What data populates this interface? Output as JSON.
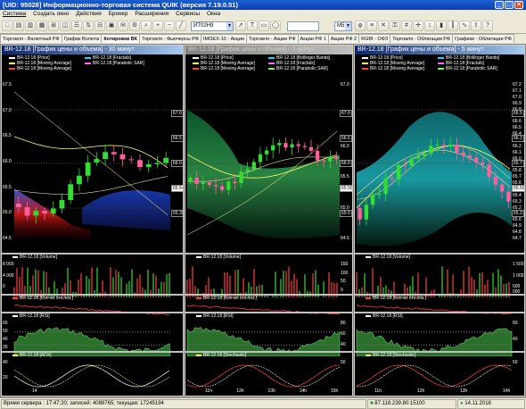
{
  "window": {
    "title": "[UID: 95028] Информационно-торговая система QUIK (версия 7.19.0.51)",
    "minimize": "_",
    "maximize": "□",
    "close": "✕"
  },
  "menu": [
    "Система",
    "Создать окно",
    "Действия",
    "Брокер",
    "Расширения",
    "Сервисы",
    "Окна"
  ],
  "toolbar": {
    "instrument": "ИТ02Н9",
    "interval": "M5",
    "icons": [
      "new-window-icon",
      "open-icon",
      "save-icon",
      "print-icon",
      "table-icon",
      "chart-icon",
      "quote-icon",
      "order-icon",
      "stop-icon",
      "portfolio-icon",
      "news-icon",
      "settings-icon",
      "search-icon",
      "zoom-in-icon",
      "zoom-out-icon",
      "line-icon",
      "arrow-icon",
      "text-icon",
      "rect-icon",
      "ellipse-icon",
      "fib-icon",
      "channel-icon",
      "delete-icon",
      "lock-icon",
      "grid-icon",
      "crosshair-icon",
      "scale-icon",
      "candle-icon",
      "bar-icon",
      "linechart-icon",
      "export-icon",
      "help-icon"
    ]
  },
  "tabs": [
    {
      "label": "Торговля - Валютный РФ"
    },
    {
      "label": "График Волюта"
    },
    {
      "label": "Котировки ВК",
      "active": true
    },
    {
      "label": "Торговля - Фьючерсы РФ"
    },
    {
      "label": "IMOEX-10 - Акции"
    },
    {
      "label": "Торговля - Акции РФ"
    },
    {
      "label": "Акции РФ 1"
    },
    {
      "label": "Акции РФ 2"
    },
    {
      "label": "RGBI - ОФЗ"
    },
    {
      "label": "Торговля - Облигации РФ"
    },
    {
      "label": "Графики - Облигации РФ"
    }
  ],
  "charts": [
    {
      "title": "BR-12.18 [График цены и объема] - 30 минут",
      "active": true,
      "legend": [
        "BR-12.18 [Price]",
        "BR-12.18 [Moving Average]",
        "BR-12.18 [Moving Average]",
        "BR-12.18 [Fractals]",
        "BR-12.18 [Parabolic SAR]"
      ],
      "price_ticks": [
        "67.5",
        "67.0",
        "66.5",
        "66.0",
        "65.5",
        "65.0",
        "64.5"
      ],
      "right_badges": [
        "67.0",
        "66.5",
        "66.0",
        "65.64",
        "65.39"
      ],
      "volume_label": "BR-12.18 [Volume]",
      "volume_ticks": [
        "8 000",
        "4 000",
        "0"
      ],
      "oi_label": "BR-12.18 [Кол-во отк.поз.]",
      "rsi_label": "BR-12.18 [RSI]",
      "rsi_ticks": [
        "60",
        "50",
        "40",
        "30"
      ],
      "adx_label": "BR-12.18 [ADX]",
      "adx_ticks": [
        "40",
        "20"
      ],
      "time_ticks": [
        "14"
      ]
    },
    {
      "title": "BR-12.18 [График цены и объема] - 5 минут",
      "active": false,
      "legend": [
        "BR-12.18 [Price]",
        "BR-12.18 [Moving Average]",
        "BR-12.18 [Moving Average]",
        "BR-12.18 [Bollinger Bands]",
        "BR-12.18 [Fractals]",
        "BR-12.18 [Parabolic SAR]"
      ],
      "price_ticks": [
        "67.0",
        "66.5",
        "66.0",
        "65.5",
        "65.0",
        "64.5"
      ],
      "right_badges": [
        "67.0",
        "66.5",
        "66.0",
        "65.50",
        "65.0"
      ],
      "volume_label": "BR-12.18 [Volume]",
      "volume_ticks": [
        "150",
        "100",
        "50",
        "0"
      ],
      "oi_label": "BR-12.18 [Кол-во отк.поз.]",
      "rsi_label": "BR-12.18 [RSI]",
      "rsi_ticks": [
        "80",
        "60",
        "40"
      ],
      "adx_label": "BR-12.18 [Stochastic]",
      "adx_ticks": [
        "50"
      ],
      "time_ticks": [
        "11h",
        "12h",
        "13h",
        "14h",
        "15h"
      ]
    },
    {
      "title": "BR-12.18 [График цены и объема] - 5 минут",
      "active": true,
      "legend": [
        "BR-12.18 [Price]",
        "BR-12.18 [Moving Average]",
        "BR-12.18 [Moving Average]",
        "BR-12.18 [Bollinger Bands]",
        "BR-12.18 [Fractals]",
        "BR-12.18 [Parabolic SAR]"
      ],
      "price_ticks": [
        "67.2",
        "67.1",
        "67.0",
        "66.9",
        "66.8",
        "66.7",
        "66.6",
        "66.5",
        "66.4",
        "66.3",
        "66.2",
        "66.1",
        "66.0",
        "65.9",
        "65.8",
        "65.7",
        "65.6",
        "65.5",
        "65.4",
        "65.3",
        "65.2",
        "65.1",
        "65.0",
        "64.9",
        "64.8",
        "64.7"
      ],
      "right_badges": [
        "66.5",
        "66.3",
        "65.7",
        "65.50",
        "65.3"
      ],
      "volume_label": "BR-12.18 [Volume]",
      "volume_ticks": [
        "1 500",
        "1 000",
        "500 000"
      ],
      "oi_label": "BR-12.18 [Кол-во отк.поз.]",
      "rsi_label": "BR-12.18 [RSI]",
      "rsi_ticks": [
        "60",
        "40"
      ],
      "adx_label": "BR-12.18 [Stochastic]",
      "adx_ticks": [
        "50"
      ],
      "time_ticks": [
        "11h",
        "12h",
        "13h",
        "14h"
      ]
    }
  ],
  "status": {
    "server_time": "Время сервера : 17:47:20; записей: 4088765; текущая: 17245194",
    "connection": "87.118.239.80:15100",
    "date": "14.11.2018"
  }
}
